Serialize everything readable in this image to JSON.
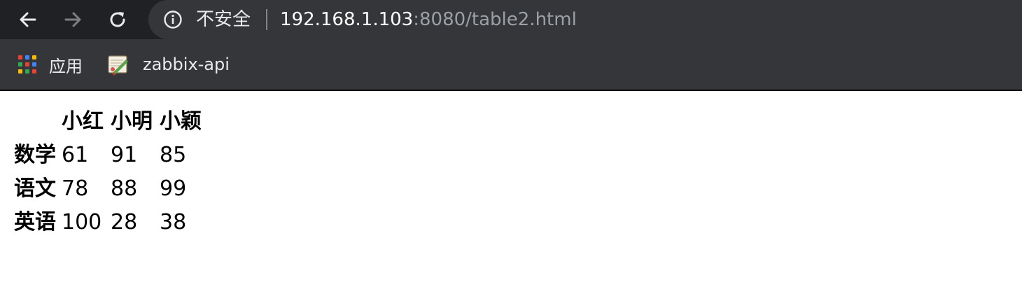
{
  "browser": {
    "omnibox": {
      "security_label": "不安全",
      "url_host": "192.168.1.103",
      "url_rest": ":8080/table2.html"
    },
    "bookmarks": [
      {
        "label": "应用",
        "icon": "apps-grid-icon"
      },
      {
        "label": "zabbix-api",
        "icon": "bookmark-favicon-icon"
      }
    ],
    "colors": {
      "toolbar_bg": "#202124",
      "omnibox_bg": "#35363a",
      "text_primary": "#e8eaed",
      "text_secondary": "#9aa0a6"
    }
  },
  "table": {
    "headers": [
      "",
      "小红",
      "小明",
      "小颖"
    ],
    "rows": [
      {
        "subject": "数学",
        "values": [
          "61",
          "91",
          "85"
        ]
      },
      {
        "subject": "语文",
        "values": [
          "78",
          "88",
          "99"
        ]
      },
      {
        "subject": "英语",
        "values": [
          "100",
          "28",
          "38"
        ]
      }
    ]
  }
}
